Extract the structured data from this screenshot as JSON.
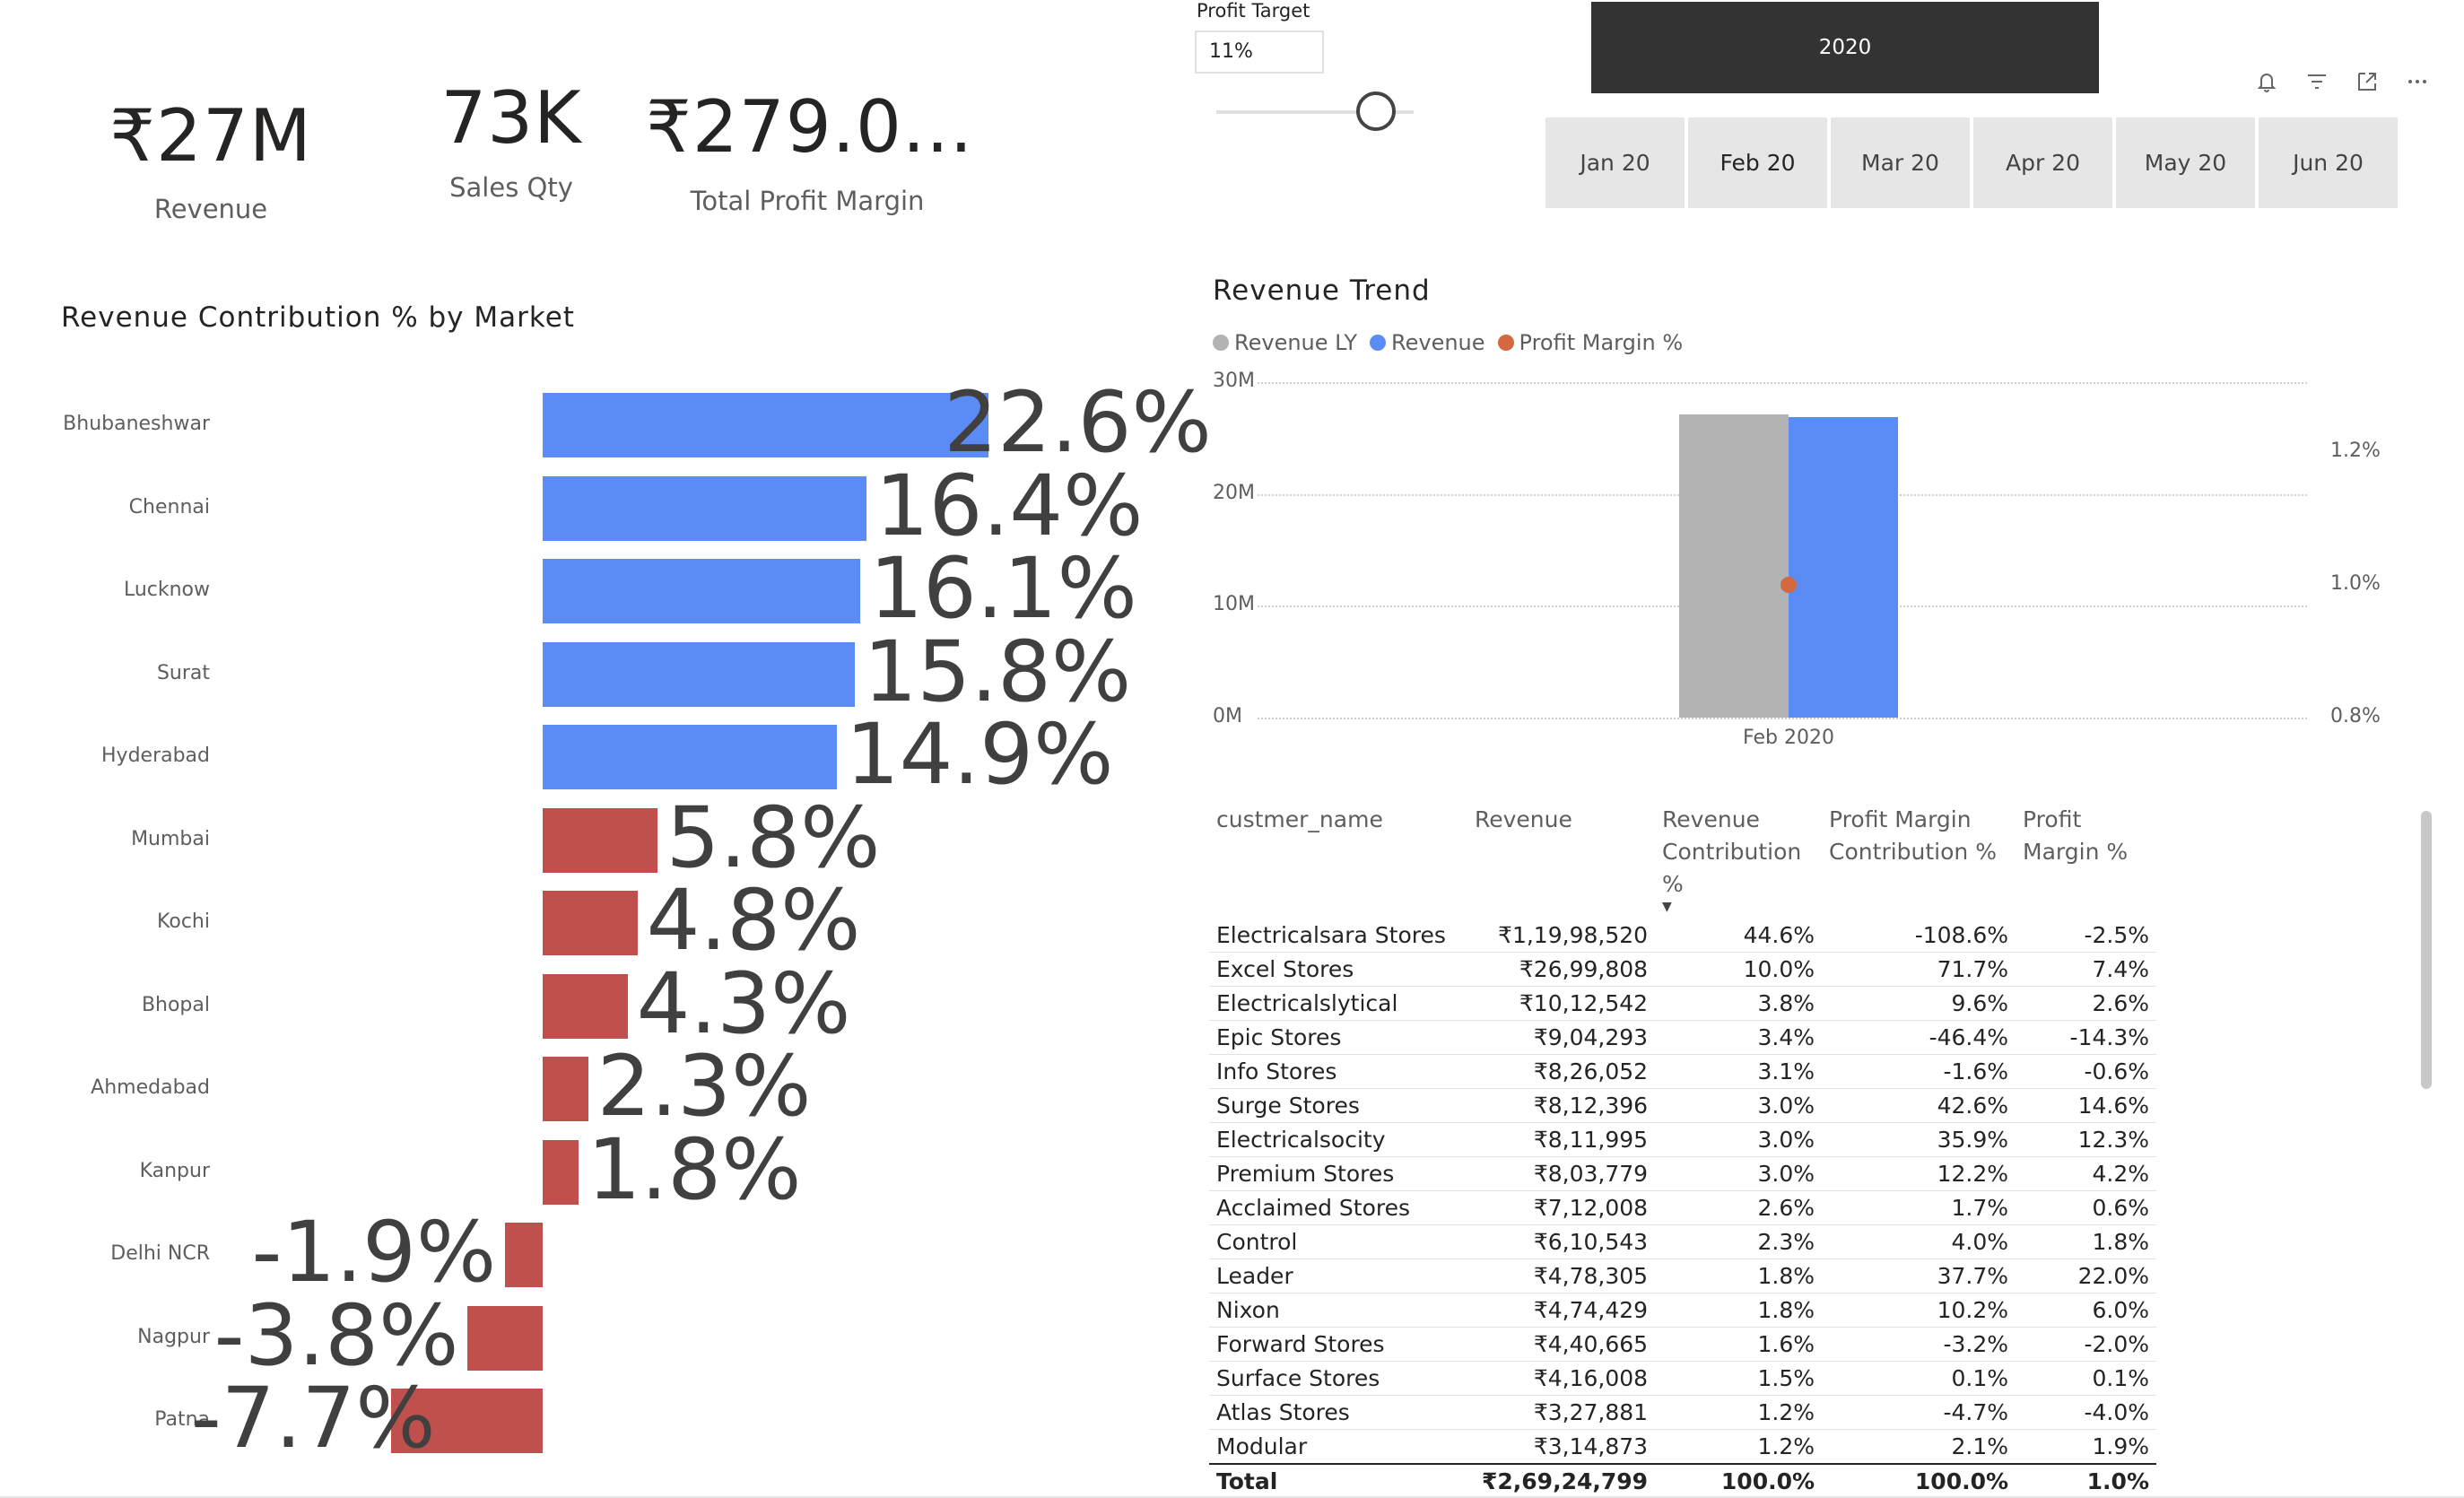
{
  "kpis": {
    "revenue": {
      "value": "₹27M",
      "label": "Revenue"
    },
    "sales_qty": {
      "value": "73K",
      "label": "Sales Qty"
    },
    "profit_margin": {
      "value": "₹279.0...",
      "label": "Total Profit Margin"
    }
  },
  "profit_target": {
    "label": "Profit Target",
    "value": "11%"
  },
  "year_slicer": {
    "selected": "2020"
  },
  "month_slicer": {
    "months": [
      "Jan 20",
      "Feb 20",
      "Mar 20",
      "Apr 20",
      "May 20",
      "Jun 20"
    ],
    "selected": "Feb 20"
  },
  "visual_header_icons": [
    "bell-icon",
    "filter-icon",
    "focus-mode-icon",
    "more-options-icon"
  ],
  "market_chart": {
    "title": "Revenue Contribution % by Market",
    "positive_color": "#5b8cf5",
    "negative_color": "#c0504d",
    "chart_data": {
      "type": "bar",
      "orientation": "horizontal",
      "categories": [
        "Bhubaneshwar",
        "Chennai",
        "Lucknow",
        "Surat",
        "Hyderabad",
        "Mumbai",
        "Kochi",
        "Bhopal",
        "Ahmedabad",
        "Kanpur",
        "Delhi NCR",
        "Nagpur",
        "Patna"
      ],
      "values": [
        22.6,
        16.4,
        16.1,
        15.8,
        14.9,
        5.8,
        4.8,
        4.3,
        2.3,
        1.8,
        -1.9,
        -3.8,
        -7.7
      ],
      "labels": [
        "22.6%",
        "16.4%",
        "16.1%",
        "15.8%",
        "14.9%",
        "5.8%",
        "4.8%",
        "4.3%",
        "2.3%",
        "1.8%",
        "-1.9%",
        "-3.8%",
        "-7.7%"
      ]
    }
  },
  "trend_chart": {
    "title": "Revenue Trend",
    "legend": [
      {
        "name": "Revenue LY",
        "color": "#b3b3b3"
      },
      {
        "name": "Revenue",
        "color": "#5b8cf5"
      },
      {
        "name": "Profit Margin %",
        "color": "#d4693f"
      }
    ],
    "chart_data": {
      "type": "bar",
      "categories": [
        "Feb 2020"
      ],
      "series": [
        {
          "name": "Revenue LY",
          "values": [
            27.1
          ]
        },
        {
          "name": "Revenue",
          "values": [
            26.9
          ]
        },
        {
          "name": "Profit Margin %",
          "values": [
            1.0
          ],
          "axis": "right"
        }
      ],
      "y_ticks": [
        "0M",
        "10M",
        "20M",
        "30M"
      ],
      "ylim": [
        0,
        30
      ],
      "y2_ticks": [
        "0.8%",
        "1.0%",
        "1.2%"
      ],
      "y2lim": [
        0.8,
        1.3
      ]
    }
  },
  "table": {
    "columns": [
      "custmer_name",
      "Revenue",
      "Revenue Contribution %",
      "Profit Margin Contribution %",
      "Profit Margin %"
    ],
    "rows": [
      [
        "Electricalsara Stores",
        "₹1,19,98,520",
        "44.6%",
        "-108.6%",
        "-2.5%"
      ],
      [
        "Excel Stores",
        "₹26,99,808",
        "10.0%",
        "71.7%",
        "7.4%"
      ],
      [
        "Electricalslytical",
        "₹10,12,542",
        "3.8%",
        "9.6%",
        "2.6%"
      ],
      [
        "Epic Stores",
        "₹9,04,293",
        "3.4%",
        "-46.4%",
        "-14.3%"
      ],
      [
        "Info Stores",
        "₹8,26,052",
        "3.1%",
        "-1.6%",
        "-0.6%"
      ],
      [
        "Surge Stores",
        "₹8,12,396",
        "3.0%",
        "42.6%",
        "14.6%"
      ],
      [
        "Electricalsocity",
        "₹8,11,995",
        "3.0%",
        "35.9%",
        "12.3%"
      ],
      [
        "Premium Stores",
        "₹8,03,779",
        "3.0%",
        "12.2%",
        "4.2%"
      ],
      [
        "Acclaimed Stores",
        "₹7,12,008",
        "2.6%",
        "1.7%",
        "0.6%"
      ],
      [
        "Control",
        "₹6,10,543",
        "2.3%",
        "4.0%",
        "1.8%"
      ],
      [
        "Leader",
        "₹4,78,305",
        "1.8%",
        "37.7%",
        "22.0%"
      ],
      [
        "Nixon",
        "₹4,74,429",
        "1.8%",
        "10.2%",
        "6.0%"
      ],
      [
        "Forward Stores",
        "₹4,40,665",
        "1.6%",
        "-3.2%",
        "-2.0%"
      ],
      [
        "Surface Stores",
        "₹4,16,008",
        "1.5%",
        "0.1%",
        "0.1%"
      ],
      [
        "Atlas Stores",
        "₹3,27,881",
        "1.2%",
        "-4.7%",
        "-4.0%"
      ],
      [
        "Modular",
        "₹3,14,873",
        "1.2%",
        "2.1%",
        "1.9%"
      ]
    ],
    "total": [
      "Total",
      "₹2,69,24,799",
      "100.0%",
      "100.0%",
      "1.0%"
    ]
  }
}
